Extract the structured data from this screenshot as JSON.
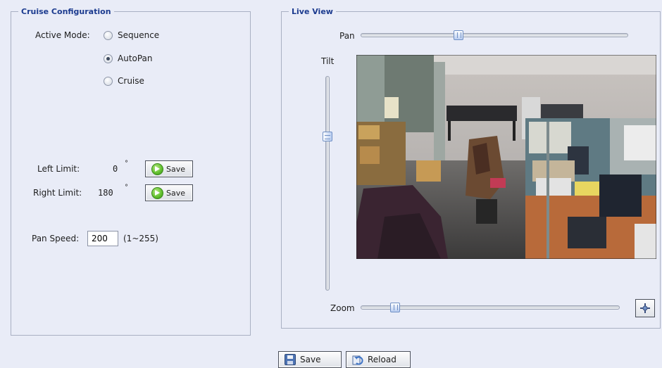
{
  "cruise": {
    "legend": "Cruise Configuration",
    "active_mode_label": "Active Mode:",
    "modes": [
      {
        "label": "Sequence",
        "checked": false
      },
      {
        "label": "AutoPan",
        "checked": true
      },
      {
        "label": "Cruise",
        "checked": false
      }
    ],
    "left_limit": {
      "label": "Left Limit:",
      "value": "0",
      "unit": "°",
      "button": "Save"
    },
    "right_limit": {
      "label": "Right Limit:",
      "value": "180",
      "unit": "°",
      "button": "Save"
    },
    "pan_speed": {
      "label": "Pan Speed:",
      "value": "200",
      "range": "(1~255)"
    }
  },
  "live_view": {
    "legend": "Live View",
    "pan_label": "Pan",
    "tilt_label": "Tilt",
    "zoom_label": "Zoom",
    "pan_level": 0.36,
    "tilt_level": 0.27,
    "zoom_level": 0.12
  },
  "footer": {
    "save_label": "Save",
    "reload_label": "Reload"
  },
  "colors": {
    "background": "#e9ecf7",
    "legend_text": "#1c3b8f",
    "border": "#a9b0c3"
  }
}
